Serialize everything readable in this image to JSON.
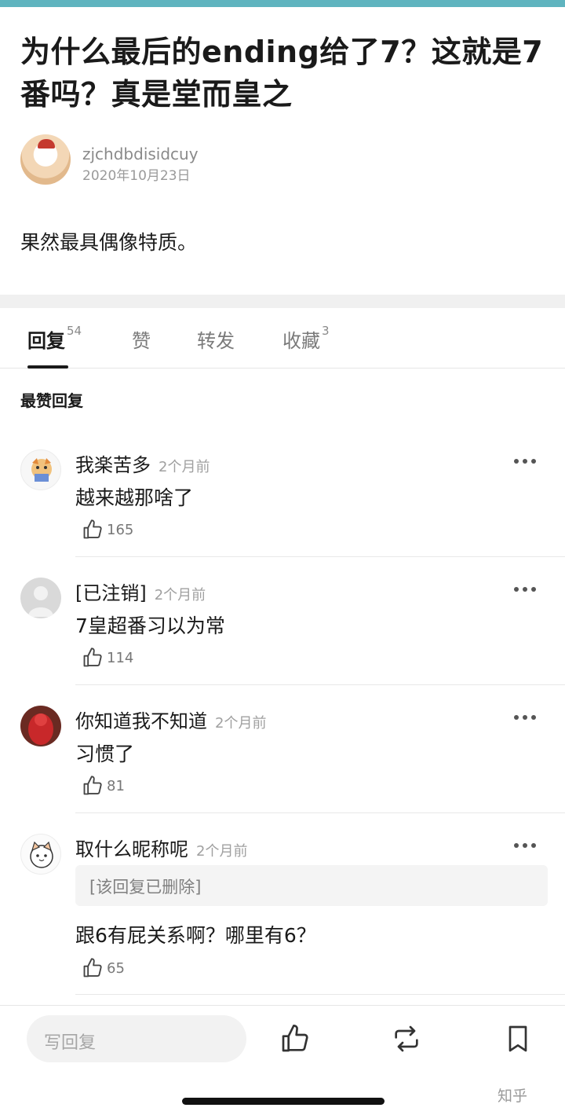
{
  "post": {
    "title": "为什么最后的ending给了7？这就是7番吗？真是堂而皇之",
    "author": "zjchdbdisidcuy",
    "date": "2020年10月23日",
    "body": "果然最具偶像特质。"
  },
  "tabs": [
    {
      "label": "回复",
      "count": "54"
    },
    {
      "label": "赞",
      "count": ""
    },
    {
      "label": "转发",
      "count": ""
    },
    {
      "label": "收藏",
      "count": "3"
    }
  ],
  "section_label": "最赞回复",
  "comments": [
    {
      "name": "我楽苦多",
      "time": "2个月前",
      "text": "越来越那啥了",
      "likes": "165"
    },
    {
      "name": "[已注销]",
      "time": "2个月前",
      "text": "7皇超番习以为常",
      "likes": "114"
    },
    {
      "name": "你知道我不知道",
      "time": "2个月前",
      "text": "习惯了",
      "likes": "81"
    },
    {
      "name": "取什么昵称呢",
      "time": "2个月前",
      "quote": "[该回复已删除]",
      "text": "跟6有屁关系啊？哪里有6？",
      "likes": "65"
    }
  ],
  "bottom": {
    "reply_placeholder": "写回复",
    "watermark": "知乎"
  },
  "colors": {
    "accent_bar": "#5fb4bf",
    "text": "#1a1a1a",
    "muted": "#a0a0a0"
  },
  "icons": [
    "more-icon",
    "thumbs-up-icon",
    "repost-icon",
    "bookmark-icon"
  ]
}
